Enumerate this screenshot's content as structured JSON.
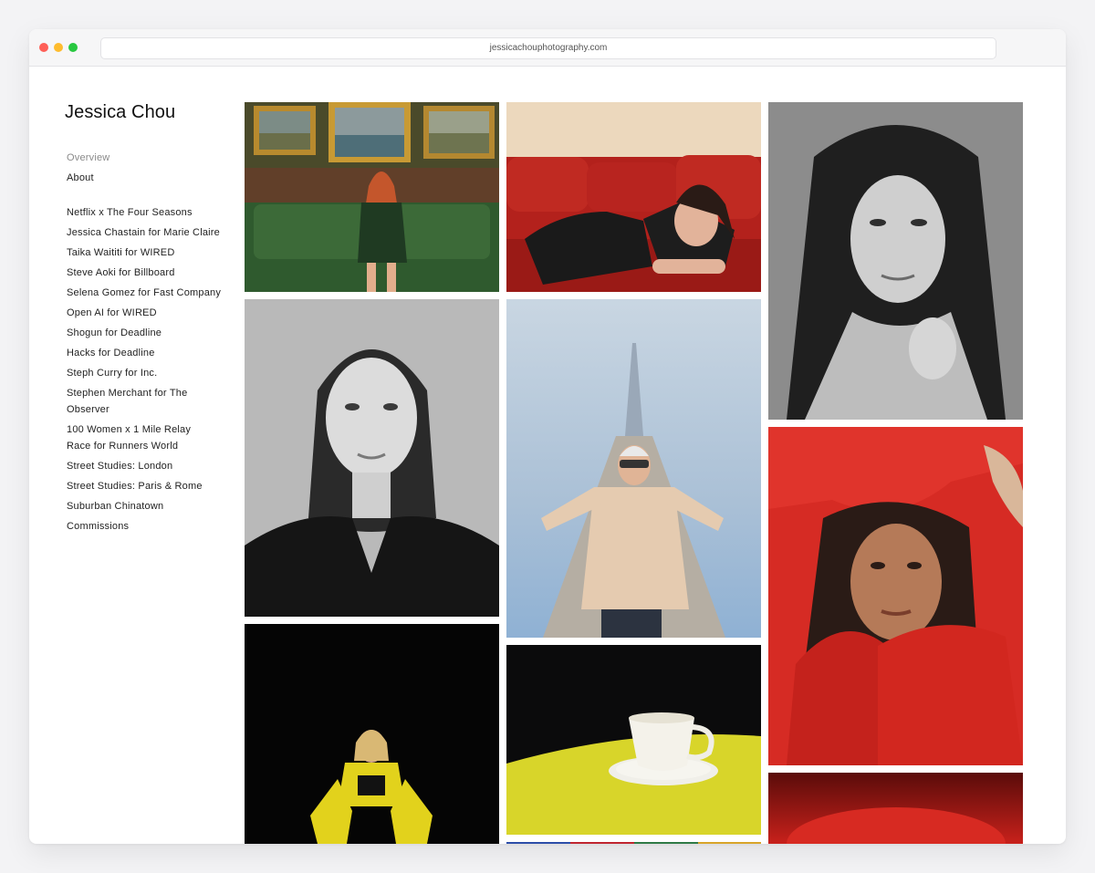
{
  "browser": {
    "url": "jessicachouphotography.com"
  },
  "site": {
    "title": "Jessica Chou"
  },
  "nav": {
    "top": [
      "Overview",
      "About"
    ],
    "projects": [
      "Netflix x The Four Seasons",
      "Jessica Chastain for Marie Claire",
      "Taika Waititi for WIRED",
      "Steve Aoki for Billboard",
      "Selena Gomez for Fast Company",
      "Open AI for WIRED",
      "Shogun for Deadline",
      "Hacks for Deadline",
      "Steph Curry for Inc.",
      "Stephen Merchant for The Observer",
      "100 Women x 1 Mile Relay Race for Runners World",
      "Street Studies: London",
      "Street Studies: Paris & Rome",
      "Suburban Chinatown",
      "Commissions"
    ]
  },
  "gallery": {
    "columns": [
      [
        "portrait-paintings-green-sofa",
        "portrait-bw-woman-bob",
        "portrait-yellow-suit-black-bg"
      ],
      [
        "portrait-woman-red-sofa",
        "portrait-man-sky-spire",
        "still-life-teacup-yellow-table",
        "strip-colorful"
      ],
      [
        "portrait-bw-woman-long-hair",
        "portrait-woman-red-fabric",
        "strip-red"
      ]
    ]
  }
}
